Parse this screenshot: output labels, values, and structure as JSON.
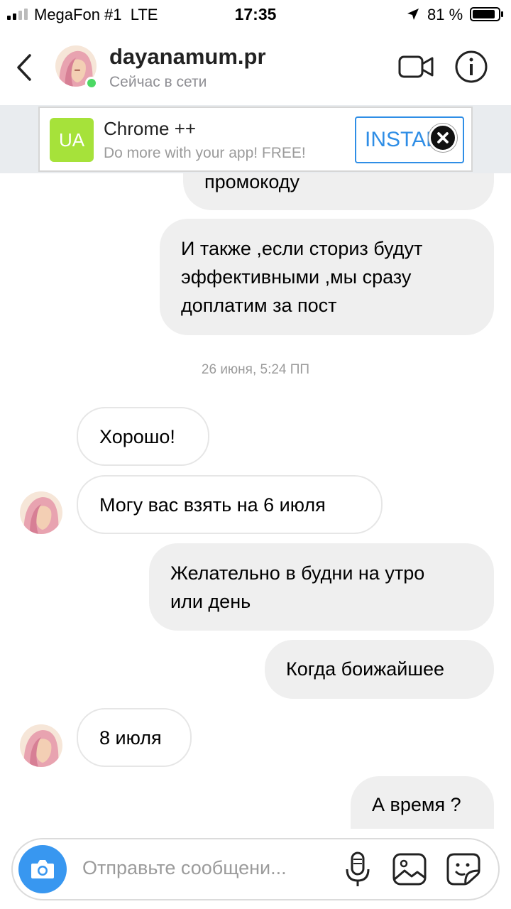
{
  "status_bar": {
    "carrier": "MegaFon #1",
    "network": "LTE",
    "time": "17:35",
    "battery_percent": "81 %"
  },
  "header": {
    "username": "dayanamum.pr",
    "status": "Сейчас в сети",
    "online_color": "#4cd964"
  },
  "ad": {
    "logo_text": "UA",
    "title": "Chrome ++",
    "subtitle": "Do more with your app! FREE!",
    "button_label": "INSTALL",
    "accent": "#2f8ee6"
  },
  "messages": [
    {
      "side": "out",
      "text": "промокоду"
    },
    {
      "side": "out",
      "lines": [
        "И также ,если сториз будут",
        "эффективными ,мы сразу",
        "доплатим за пост"
      ]
    },
    {
      "side": "in",
      "text": "Хорошо!"
    },
    {
      "side": "in",
      "text": "Могу вас взять на 6 июля"
    },
    {
      "side": "out",
      "lines": [
        "Желательно в будни на утро",
        "или день"
      ]
    },
    {
      "side": "out",
      "text": "Когда боижайшее"
    },
    {
      "side": "in",
      "text": "8 июля"
    },
    {
      "side": "out",
      "text": "А время ?"
    }
  ],
  "timestamp": "26 июня, 5:24 ПП",
  "composer": {
    "placeholder": "Отправьте сообщени...",
    "camera_color": "#3897f0"
  },
  "icons": [
    "back-chevron-icon",
    "video-camera-icon",
    "info-icon",
    "close-icon",
    "camera-icon",
    "microphone-icon",
    "gallery-icon",
    "sticker-icon"
  ]
}
